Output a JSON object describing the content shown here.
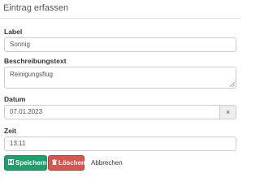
{
  "dialog": {
    "title": "Eintrag erfassen"
  },
  "form": {
    "label": {
      "label": "Label",
      "value": "Sonnig"
    },
    "description": {
      "label": "Beschreibungstext",
      "value": "Reinigungsflug"
    },
    "date": {
      "label": "Datum",
      "value": "07.01.2023",
      "clear_symbol": "×"
    },
    "time": {
      "label": "Zeit",
      "value": "13:11"
    }
  },
  "actions": {
    "save_label": "Speichern",
    "delete_label": "Löschen",
    "cancel_label": "Abbrechen",
    "save_icon": "floppy-disk-icon",
    "delete_icon": "trash-icon"
  },
  "colors": {
    "save": "#18a36b",
    "delete": "#d9534f",
    "input_border": "#cccccc",
    "addon_background": "#eeeeee"
  }
}
